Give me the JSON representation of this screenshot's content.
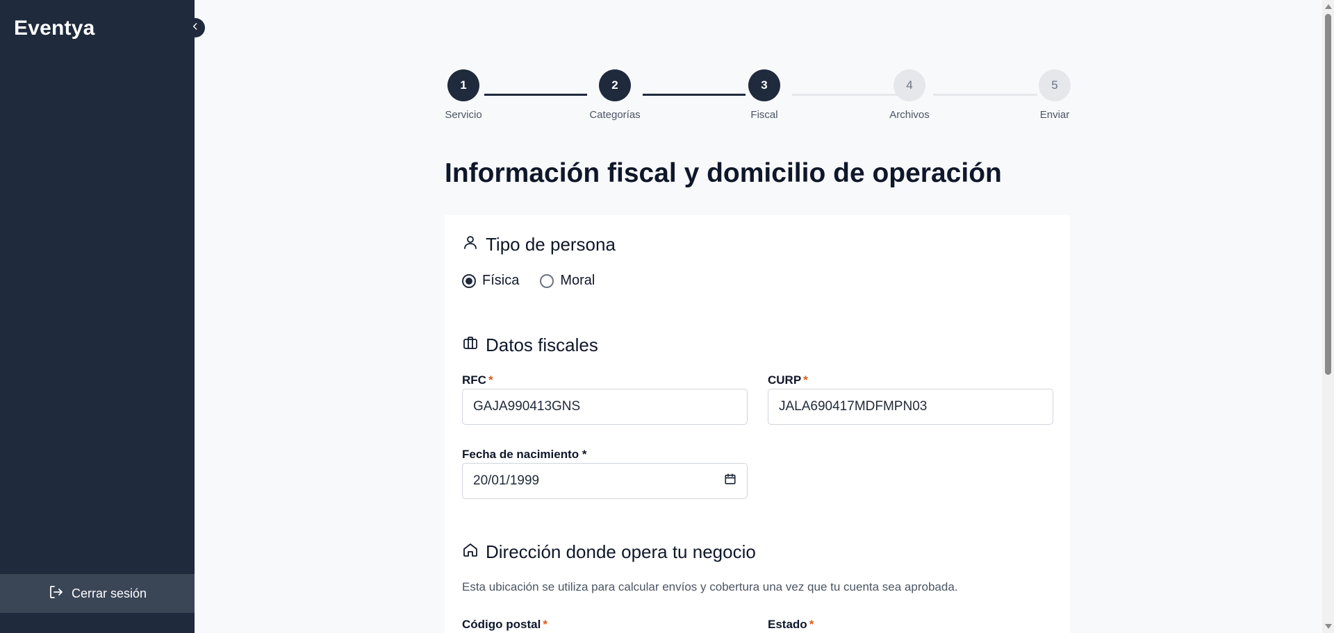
{
  "sidebar": {
    "brand": "Eventya",
    "logout_label": "Cerrar sesión"
  },
  "stepper": {
    "steps": [
      {
        "number": "1",
        "label": "Servicio",
        "state": "done"
      },
      {
        "number": "2",
        "label": "Categorías",
        "state": "done"
      },
      {
        "number": "3",
        "label": "Fiscal",
        "state": "current"
      },
      {
        "number": "4",
        "label": "Archivos",
        "state": "todo"
      },
      {
        "number": "5",
        "label": "Enviar",
        "state": "todo"
      }
    ]
  },
  "page": {
    "title": "Información fiscal y domicilio de operación"
  },
  "tipo_persona": {
    "title": "Tipo de persona",
    "options": [
      {
        "label": "Física",
        "checked": true
      },
      {
        "label": "Moral",
        "checked": false
      }
    ]
  },
  "datos_fiscales": {
    "title": "Datos fiscales",
    "rfc_label": "RFC",
    "rfc_value": "GAJA990413GNS",
    "curp_label": "CURP",
    "curp_value": "JALA690417MDFMPN03",
    "fecha_label": "Fecha de nacimiento *",
    "fecha_value": "20/01/1999"
  },
  "direccion": {
    "title": "Dirección donde opera tu negocio",
    "helper": "Esta ubicación se utiliza para calcular envíos y cobertura una vez que tu cuenta sea aprobada.",
    "cp_label": "Código postal",
    "estado_label": "Estado"
  },
  "required_mark": "*",
  "colors": {
    "sidebar": "#1f2a3c",
    "accent": "#1f2a3c",
    "required": "#dc5b1a",
    "background": "#f8f9fb"
  }
}
